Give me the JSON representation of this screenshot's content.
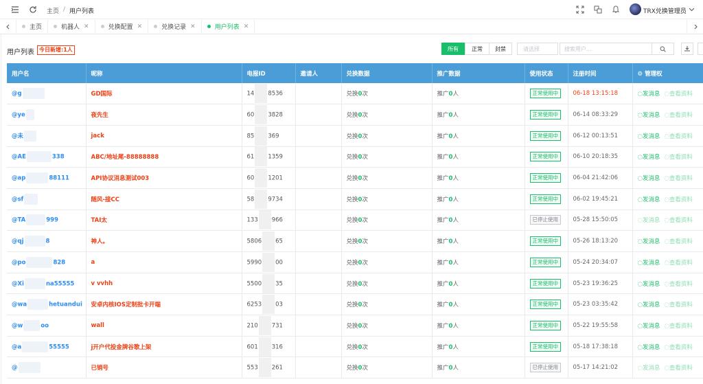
{
  "header": {
    "breadcrumb_home": "主页",
    "breadcrumb_sep": "/",
    "breadcrumb_current": "用户列表",
    "user_name": "TRX兑换管理员"
  },
  "tabs": [
    {
      "label": "主页",
      "active": false,
      "closable": false
    },
    {
      "label": "机器人",
      "active": false,
      "closable": true
    },
    {
      "label": "兑换配置",
      "active": false,
      "closable": true
    },
    {
      "label": "兑换记录",
      "active": false,
      "closable": true
    },
    {
      "label": "用户列表",
      "active": true,
      "closable": true
    }
  ],
  "toolbar": {
    "title": "用户列表",
    "new_today": "今日新增:1人",
    "filter_all": "所有",
    "filter_normal": "正常",
    "filter_banned": "封禁",
    "select_placeholder": "请选择",
    "search_placeholder": "搜索用户..."
  },
  "table": {
    "columns": [
      "用户名",
      "昵称",
      "电报ID",
      "邀请人",
      "兑换数据",
      "推广数据",
      "使用状态",
      "注册时间",
      "管理权"
    ],
    "exchange_prefix": "兑换",
    "exchange_suffix": "次",
    "promo_prefix": "推广",
    "promo_suffix": "人",
    "action_message": "发消息",
    "action_view": "查看资料",
    "rows": [
      {
        "user_pre": "@g",
        "user_post": "",
        "nick": "GD国际",
        "tel_pre": "14",
        "tel_post": "8536",
        "exchange": "0",
        "promo": "0",
        "status": "正常使用中",
        "active": true,
        "time": "06-18 13:15:18",
        "recent": true
      },
      {
        "user_pre": "@ye",
        "user_post": "",
        "nick": "夜先生",
        "tel_pre": "60",
        "tel_post": "3828",
        "exchange": "0",
        "promo": "0",
        "status": "正常使用中",
        "active": true,
        "time": "06-14 08:33:29",
        "recent": false
      },
      {
        "user_pre": "@未",
        "user_post": "",
        "nick": "jack",
        "tel_pre": "85",
        "tel_post": "369",
        "exchange": "0",
        "promo": "0",
        "status": "正常使用中",
        "active": true,
        "time": "06-12 00:13:51",
        "recent": false
      },
      {
        "user_pre": "@AE",
        "user_post": "338",
        "nick": "ABC/地址尾-88888888",
        "tel_pre": "61",
        "tel_post": "1359",
        "exchange": "0",
        "promo": "0",
        "status": "正常使用中",
        "active": true,
        "time": "06-10 20:18:35",
        "recent": false
      },
      {
        "user_pre": "@ap",
        "user_post": "88111",
        "nick": "API协议消息测试003",
        "tel_pre": "60",
        "tel_post": "1201",
        "exchange": "0",
        "promo": "0",
        "status": "正常使用中",
        "active": true,
        "time": "06-04 21:42:06",
        "recent": false
      },
      {
        "user_pre": "@sf",
        "user_post": "",
        "nick": "随风-接CC",
        "tel_pre": "58",
        "tel_post": "9734",
        "exchange": "0",
        "promo": "0",
        "status": "正常使用中",
        "active": true,
        "time": "06-02 19:45:21",
        "recent": false
      },
      {
        "user_pre": "@TA",
        "user_post": "999",
        "nick": "TAI太",
        "tel_pre": "133",
        "tel_post": "966",
        "exchange": "0",
        "promo": "0",
        "status": "已停止使用",
        "active": false,
        "time": "05-28 15:50:05",
        "recent": false
      },
      {
        "user_pre": "@qj",
        "user_post": "8",
        "nick": "神人。",
        "tel_pre": "5806",
        "tel_post": "65",
        "exchange": "0",
        "promo": "0",
        "status": "正常使用中",
        "active": true,
        "time": "05-26 18:13:20",
        "recent": false
      },
      {
        "user_pre": "@po",
        "user_post": "828",
        "nick": "a",
        "tel_pre": "5990",
        "tel_post": "00",
        "exchange": "0",
        "promo": "0",
        "status": "正常使用中",
        "active": true,
        "time": "05-24 20:34:07",
        "recent": false
      },
      {
        "user_pre": "@Xi",
        "user_post": "na55555",
        "nick": "v vvhh",
        "tel_pre": "5500",
        "tel_post": "35",
        "exchange": "0",
        "promo": "0",
        "status": "正常使用中",
        "active": true,
        "time": "05-23 19:36:25",
        "recent": false
      },
      {
        "user_pre": "@wa",
        "user_post": "hetuandui",
        "nick": "安卓内核IOS定制批卡开端",
        "tel_pre": "6253",
        "tel_post": "03",
        "exchange": "0",
        "promo": "0",
        "status": "正常使用中",
        "active": true,
        "time": "05-23 03:35:42",
        "recent": false
      },
      {
        "user_pre": "@w",
        "user_post": "oo",
        "nick": "wall",
        "tel_pre": "210",
        "tel_post": "731",
        "exchange": "0",
        "promo": "0",
        "status": "正常使用中",
        "active": true,
        "time": "05-22 19:55:58",
        "recent": false
      },
      {
        "user_pre": "@a",
        "user_post": "55555",
        "nick": "j开户代投金牌谷歌上架",
        "tel_pre": "601",
        "tel_post": "316",
        "exchange": "0",
        "promo": "0",
        "status": "正常使用中",
        "active": true,
        "time": "05-18 17:38:18",
        "recent": false
      },
      {
        "user_pre": "@",
        "user_post": "",
        "nick": "已销号",
        "tel_pre": "553",
        "tel_post": "261",
        "exchange": "0",
        "promo": "0",
        "status": "已停止使用",
        "active": false,
        "time": "05-17 14:21:02",
        "recent": false
      }
    ]
  },
  "colors": {
    "accent": "#19be6b",
    "header_blue": "#4a9dd6",
    "red": "#ed4014",
    "link": "#2d8cf0"
  }
}
